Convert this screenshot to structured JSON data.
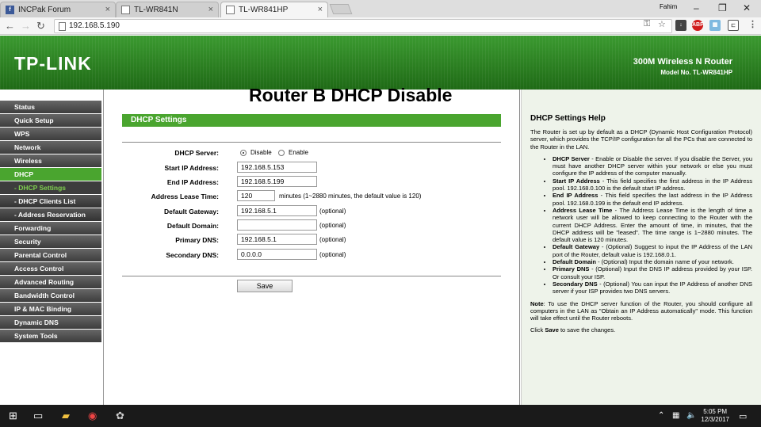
{
  "browser": {
    "tabs": [
      {
        "label": "INCPak Forum",
        "icon": "facebook-icon"
      },
      {
        "label": "TL-WR841N",
        "icon": "page-icon"
      },
      {
        "label": "TL-WR841HP",
        "icon": "page-icon"
      }
    ],
    "profile": "Fahim",
    "url": "192.168.5.190"
  },
  "banner": {
    "logo": "TP-LINK",
    "title": "300M Wireless N Router",
    "model": "Model No. TL-WR841HP"
  },
  "overlay_title": "Router B DHCP Disable",
  "sidebar": {
    "items": [
      {
        "label": "Status"
      },
      {
        "label": "Quick Setup"
      },
      {
        "label": "WPS"
      },
      {
        "label": "Network"
      },
      {
        "label": "Wireless"
      },
      {
        "label": "DHCP"
      },
      {
        "label": "- DHCP Settings"
      },
      {
        "label": "- DHCP Clients List"
      },
      {
        "label": "- Address Reservation"
      },
      {
        "label": "Forwarding"
      },
      {
        "label": "Security"
      },
      {
        "label": "Parental Control"
      },
      {
        "label": "Access Control"
      },
      {
        "label": "Advanced Routing"
      },
      {
        "label": "Bandwidth Control"
      },
      {
        "label": "IP & MAC Binding"
      },
      {
        "label": "Dynamic DNS"
      },
      {
        "label": "System Tools"
      }
    ]
  },
  "form": {
    "section_title": "DHCP Settings",
    "dhcp_server_label": "DHCP Server:",
    "disable_label": "Disable",
    "enable_label": "Enable",
    "dhcp_server_value": "Disable",
    "start_ip_label": "Start IP Address:",
    "start_ip": "192.168.5.153",
    "end_ip_label": "End IP Address:",
    "end_ip": "192.168.5.199",
    "lease_label": "Address Lease Time:",
    "lease": "120",
    "lease_note": "minutes (1~2880 minutes, the default value is 120)",
    "gateway_label": "Default Gateway:",
    "gateway": "192.168.5.1",
    "domain_label": "Default Domain:",
    "domain": "",
    "primary_dns_label": "Primary DNS:",
    "primary_dns": "192.168.5.1",
    "secondary_dns_label": "Secondary DNS:",
    "secondary_dns": "0.0.0.0",
    "optional": "(optional)",
    "save_label": "Save"
  },
  "help": {
    "title": "DHCP Settings Help",
    "intro": "The Router is set up by default as a DHCP (Dynamic Host Configuration Protocol) server, which provides the TCP/IP configuration for all the PCs that are connected to the Router in the LAN.",
    "items": [
      {
        "term": "DHCP Server",
        "text": " - Enable or Disable the server. If you disable the Server, you must have another DHCP server within your network or else you must configure the IP address of the computer manually."
      },
      {
        "term": "Start IP Address",
        "text": " - This field specifies the first address in the IP Address pool. 192.168.0.100 is the default start IP address."
      },
      {
        "term": "End IP Address",
        "text": " - This field specifies the last address in the IP Address pool. 192.168.0.199 is the default end IP address."
      },
      {
        "term": "Address Lease Time",
        "text": " - The Address Lease Time is the length of time a network user will be allowed to keep connecting to the Router with the current DHCP Address. Enter the amount of time, in minutes, that the DHCP address will be \"leased\". The time range is 1~2880 minutes. The default value is 120 minutes."
      },
      {
        "term": "Default Gateway",
        "text": " - (Optional) Suggest to input the IP Address of the LAN port of the Router, default value is 192.168.0.1."
      },
      {
        "term": "Default Domain",
        "text": " - (Optional) Input the domain name of your network."
      },
      {
        "term": "Primary DNS",
        "text": " - (Optional) Input the DNS IP address provided by your ISP. Or consult your ISP."
      },
      {
        "term": "Secondary DNS",
        "text": " - (Optional) You can input the IP Address of another DNS server if your ISP provides two DNS servers."
      }
    ],
    "note_term": "Note",
    "note": ": To use the DHCP server function of the Router, you should configure all computers in the LAN as \"Obtain an IP Address automatically\" mode. This function will take effect until the Router reboots.",
    "click_pre": "Click ",
    "click_term": "Save",
    "click_post": " to save the changes."
  },
  "taskbar": {
    "time": "5:05 PM",
    "date": "12/3/2017"
  }
}
